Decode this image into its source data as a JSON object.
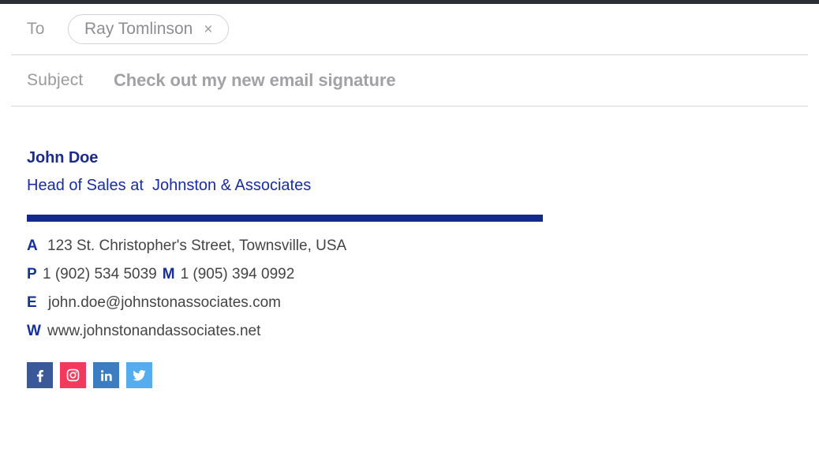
{
  "window": {
    "accent_navy": "#122a8c",
    "title_blue": "#1b2ba0",
    "top_strip_color": "#2b2f36"
  },
  "compose": {
    "to": {
      "label": "To",
      "recipients": [
        {
          "name": "Ray Tomlinson",
          "remove_glyph": "×"
        }
      ]
    },
    "subject": {
      "label": "Subject",
      "value": "Check out my new email signature"
    }
  },
  "signature": {
    "name": "John Doe",
    "title": "Head of Sales at  Johnston & Associates",
    "contacts": [
      {
        "key": "A",
        "value": "123 St. Christopher's Street, Townsville, USA"
      },
      {
        "key": "P",
        "value": "1 (902) 534 5039",
        "key2": "M",
        "value2": "1 (905) 394 0992"
      },
      {
        "key": "E",
        "value": "john.doe@johnstonassociates.com"
      },
      {
        "key": "W",
        "value": "www.johnstonandassociates.net"
      }
    ],
    "socials": [
      {
        "name": "facebook",
        "color": "#3b5998"
      },
      {
        "name": "instagram",
        "color": "#f23b5c"
      },
      {
        "name": "linkedin",
        "color": "#3b7dc0"
      },
      {
        "name": "twitter",
        "color": "#55acee"
      }
    ]
  }
}
